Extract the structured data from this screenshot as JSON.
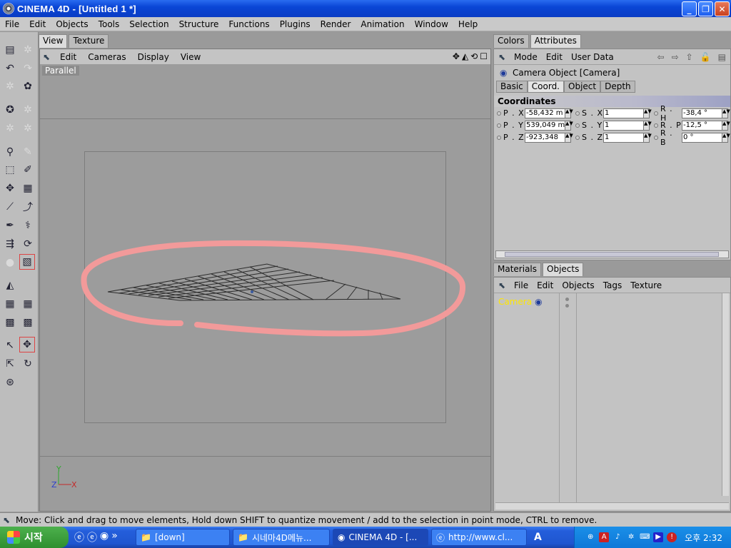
{
  "window": {
    "title": "CINEMA 4D - [Untitled 1 *]"
  },
  "menubar": [
    "File",
    "Edit",
    "Objects",
    "Tools",
    "Selection",
    "Structure",
    "Functions",
    "Plugins",
    "Render",
    "Animation",
    "Window",
    "Help"
  ],
  "viewport": {
    "tabs": [
      "View",
      "Texture"
    ],
    "menu": [
      "Edit",
      "Cameras",
      "Display",
      "View"
    ],
    "projection_label": "Parallel",
    "axes": {
      "y": "Y",
      "z": "Z",
      "x": "X"
    }
  },
  "attributes_panel": {
    "tabs": [
      "Colors",
      "Attributes"
    ],
    "menu": [
      "Mode",
      "Edit",
      "User Data"
    ],
    "object_title": "Camera Object [Camera]",
    "subtabs": [
      "Basic",
      "Coord.",
      "Object",
      "Depth"
    ],
    "section": "Coordinates",
    "rows": [
      [
        {
          "label": "P . X",
          "value": "-58,432 m"
        },
        {
          "label": "S . X",
          "value": "1"
        },
        {
          "label": "R . H",
          "value": "-38,4 °"
        }
      ],
      [
        {
          "label": "P . Y",
          "value": "539,049 m"
        },
        {
          "label": "S . Y",
          "value": "1"
        },
        {
          "label": "R . P",
          "value": "-12,5 °"
        }
      ],
      [
        {
          "label": "P . Z",
          "value": "-923,348"
        },
        {
          "label": "S . Z",
          "value": "1"
        },
        {
          "label": "R . B",
          "value": "0 °"
        }
      ]
    ]
  },
  "objects_panel": {
    "tabs": [
      "Materials",
      "Objects"
    ],
    "menu": [
      "File",
      "Edit",
      "Objects",
      "Tags",
      "Texture"
    ],
    "items": [
      {
        "name": "Camera"
      }
    ]
  },
  "statusbar": {
    "text": "Move: Click and drag to move elements, Hold down SHIFT to quantize movement / add to the selection in point mode, CTRL to remove."
  },
  "taskbar": {
    "start_label": "시작",
    "buttons": [
      "[down]",
      "시네마4D메뉴...",
      "CINEMA 4D - [...",
      "http://www.cl...",
      "A"
    ],
    "clock": "오후 2:32"
  },
  "colors": {
    "annotation": "#f29a9a",
    "title_blue": "#0a46d6",
    "object_highlight": "#ffe600"
  }
}
